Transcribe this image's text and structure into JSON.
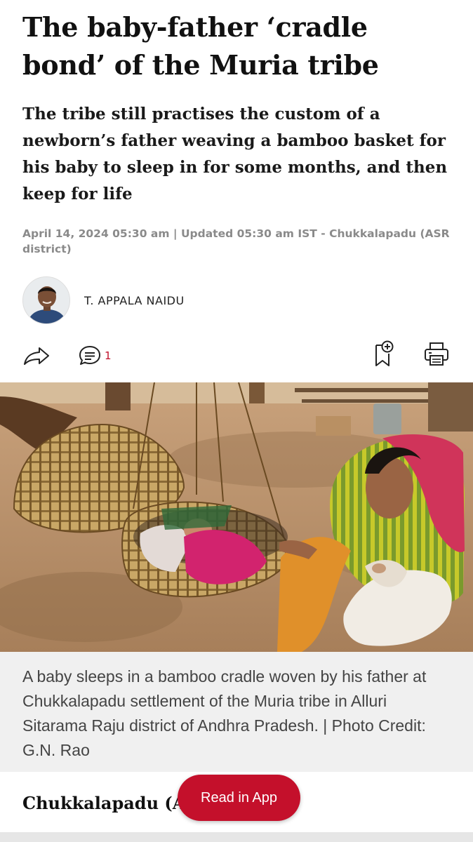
{
  "article": {
    "headline": "The baby-father ‘cradle bond’ of the Muria tribe",
    "subheadline": "The tribe still practises the custom of a newborn’s father weaving a bamboo basket for his baby to sleep in for some months, and then keep for life",
    "dateline": "April 14, 2024 05:30 am | Updated 05:30 am IST - Chukkalapadu (ASR district)",
    "author": "T. APPALA NAIDU",
    "comment_count": "1",
    "caption": "A baby sleeps in a bamboo cradle woven by his father at Chukkalapadu settlement of the Muria tribe in Alluri Sitarama Raju district of Andhra Pradesh. | Photo Credit: G.N. Rao",
    "section_heading": "Chukkalapadu (A"
  },
  "actions": {
    "share_icon": "share-icon",
    "comment_icon": "comment-icon",
    "bookmark_icon": "bookmark-add-icon",
    "print_icon": "print-icon"
  },
  "cta": {
    "read_in_app": "Read in App"
  },
  "colors": {
    "accent": "#c4102b",
    "caption_bg": "#f0f0f0",
    "meta_gray": "#8a8a8a"
  }
}
